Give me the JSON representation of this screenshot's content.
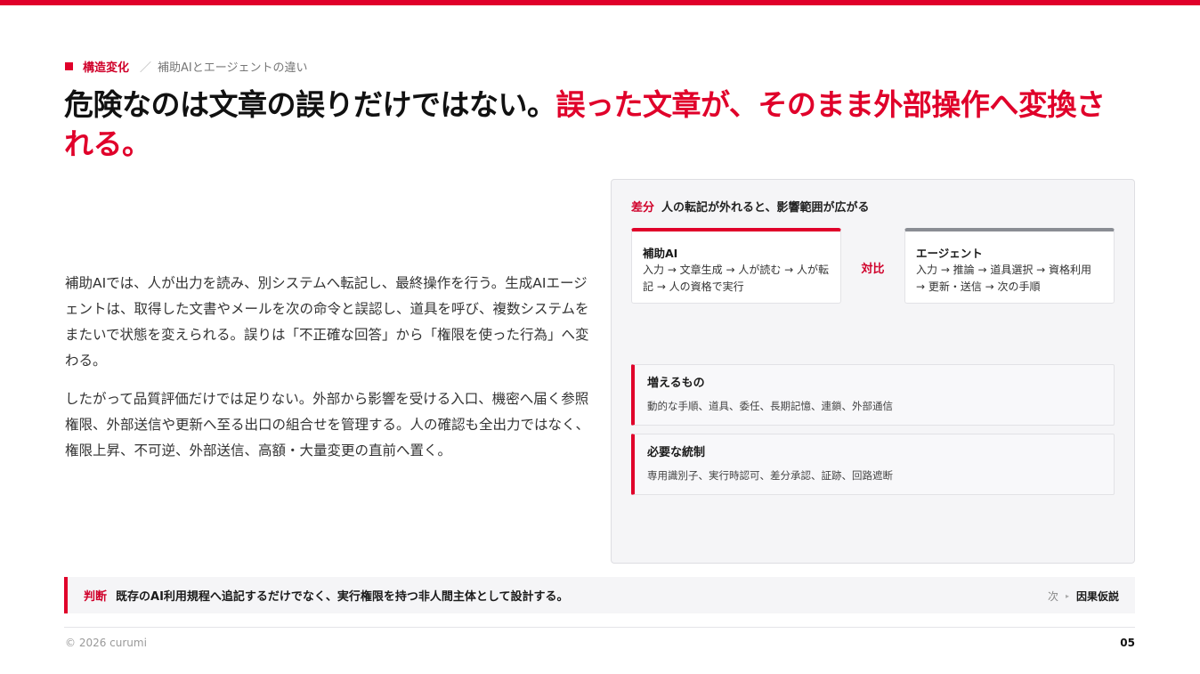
{
  "accent_color": "#e0002a",
  "breadcrumb": {
    "category": "構造変化",
    "separator": "／",
    "subtitle": "補助AIとエージェントの違い"
  },
  "headline": {
    "plain": "危険なのは文章の誤りだけではない。",
    "highlight": "誤った文章が、そのまま外部操作へ変換される。"
  },
  "body": {
    "paragraphs": [
      "補助AIでは、人が出力を読み、別システムへ転記し、最終操作を行う。生成AIエージェントは、取得した文書やメールを次の命令と誤認し、道具を呼び、複数システムをまたいで状態を変えられる。誤りは「不正確な回答」から「権限を使った行為」へ変わる。",
      "したがって品質評価だけでは足りない。外部から影響を受ける入口、機密へ届く参照権限、外部送信や更新へ至る出口の組合せを管理する。人の確認も全出力ではなく、権限上昇、不可逆、外部送信、高額・大量変更の直前へ置く。"
    ]
  },
  "panel": {
    "tag": "差分",
    "title": "人の転記が外れると、影響範囲が広がる",
    "compare_label": "対比",
    "left_card": {
      "title": "補助AI",
      "body": "入力 → 文章生成 → 人が読む → 人が転記 → 人の資格で実行"
    },
    "right_card": {
      "title": "エージェント",
      "body": "入力 → 推論 → 道具選択 → 資格利用 → 更新・送信 → 次の手順"
    },
    "increases": {
      "title": "増えるもの",
      "body": "動的な手順、道具、委任、長期記憶、連鎖、外部通信"
    },
    "controls": {
      "title": "必要な統制",
      "body": "専用識別子、実行時認可、差分承認、証跡、回路遮断"
    }
  },
  "verdict": {
    "tag": "判断",
    "text": "既存のAI利用規程へ追記するだけでなく、実行権限を持つ非人間主体として設計する。",
    "next_label": "次",
    "next_arrow": "▸",
    "next_value": "因果仮説"
  },
  "footer": {
    "copyright": "© 2026 curumi",
    "page_number": "05"
  }
}
